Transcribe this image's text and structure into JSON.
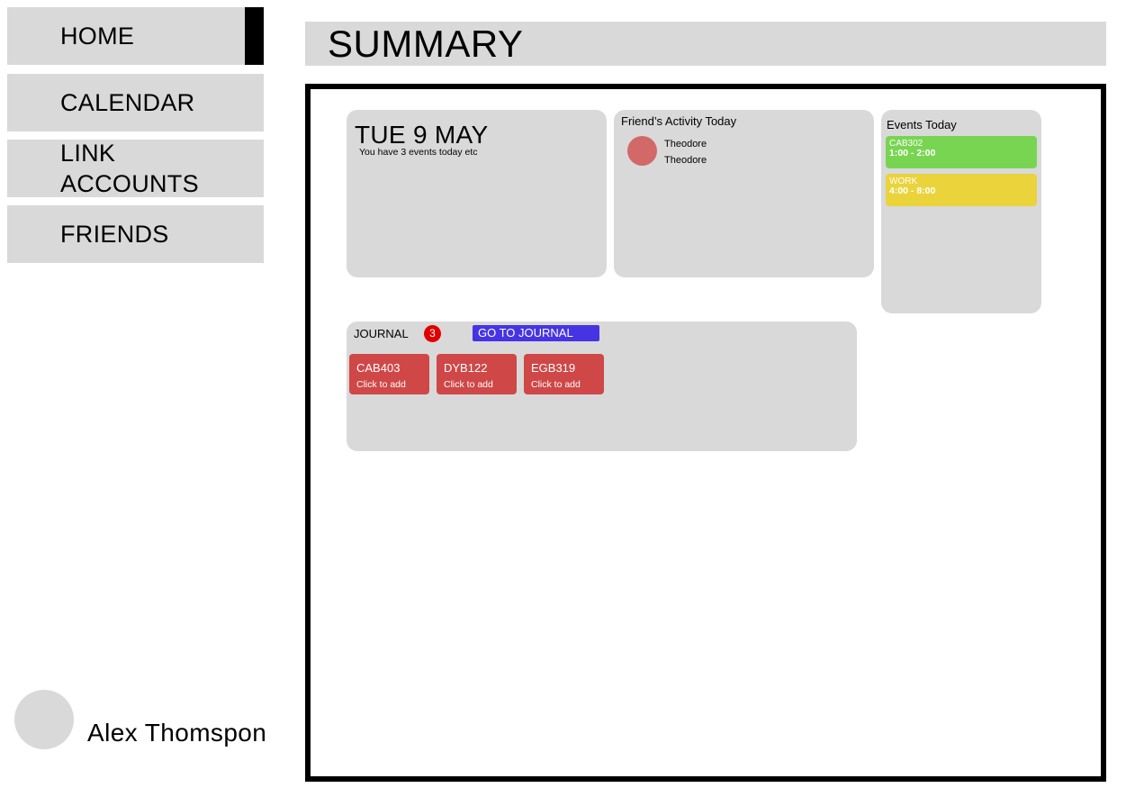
{
  "sidebar": {
    "items": [
      {
        "label": "HOME"
      },
      {
        "label": "CALENDAR"
      },
      {
        "label": "LINK\nACCOUNTS"
      },
      {
        "label": "FRIENDS"
      }
    ],
    "user": {
      "name": "Alex Thomspon"
    }
  },
  "header": {
    "title": "SUMMARY"
  },
  "today_card": {
    "date": "TUE 9 MAY",
    "subtitle": "You have 3 events today etc"
  },
  "friends_card": {
    "title": "Friend’s Activity Today",
    "lines": [
      "Theodore",
      "Theodore"
    ]
  },
  "events_card": {
    "title": "Events Today",
    "events": [
      {
        "name": "CAB302",
        "time": "1:00 - 2:00",
        "color": "#78d552"
      },
      {
        "name": "WORK",
        "time": "4:00 - 8:00",
        "color": "#ead33b"
      }
    ]
  },
  "journal_card": {
    "title": "JOURNAL",
    "badge": "3",
    "button_label": "GO TO JOURNAL",
    "entries": [
      {
        "code": "CAB403",
        "hint": "Click to add"
      },
      {
        "code": "DYB122",
        "hint": "Click to add"
      },
      {
        "code": "EGB319",
        "hint": "Click to add"
      }
    ]
  },
  "colors": {
    "panel": "#d9d9d9",
    "accent_button": "#4634e4",
    "journal_tile": "#cf4747",
    "badge": "#e00000",
    "friend_avatar": "#d26868"
  }
}
